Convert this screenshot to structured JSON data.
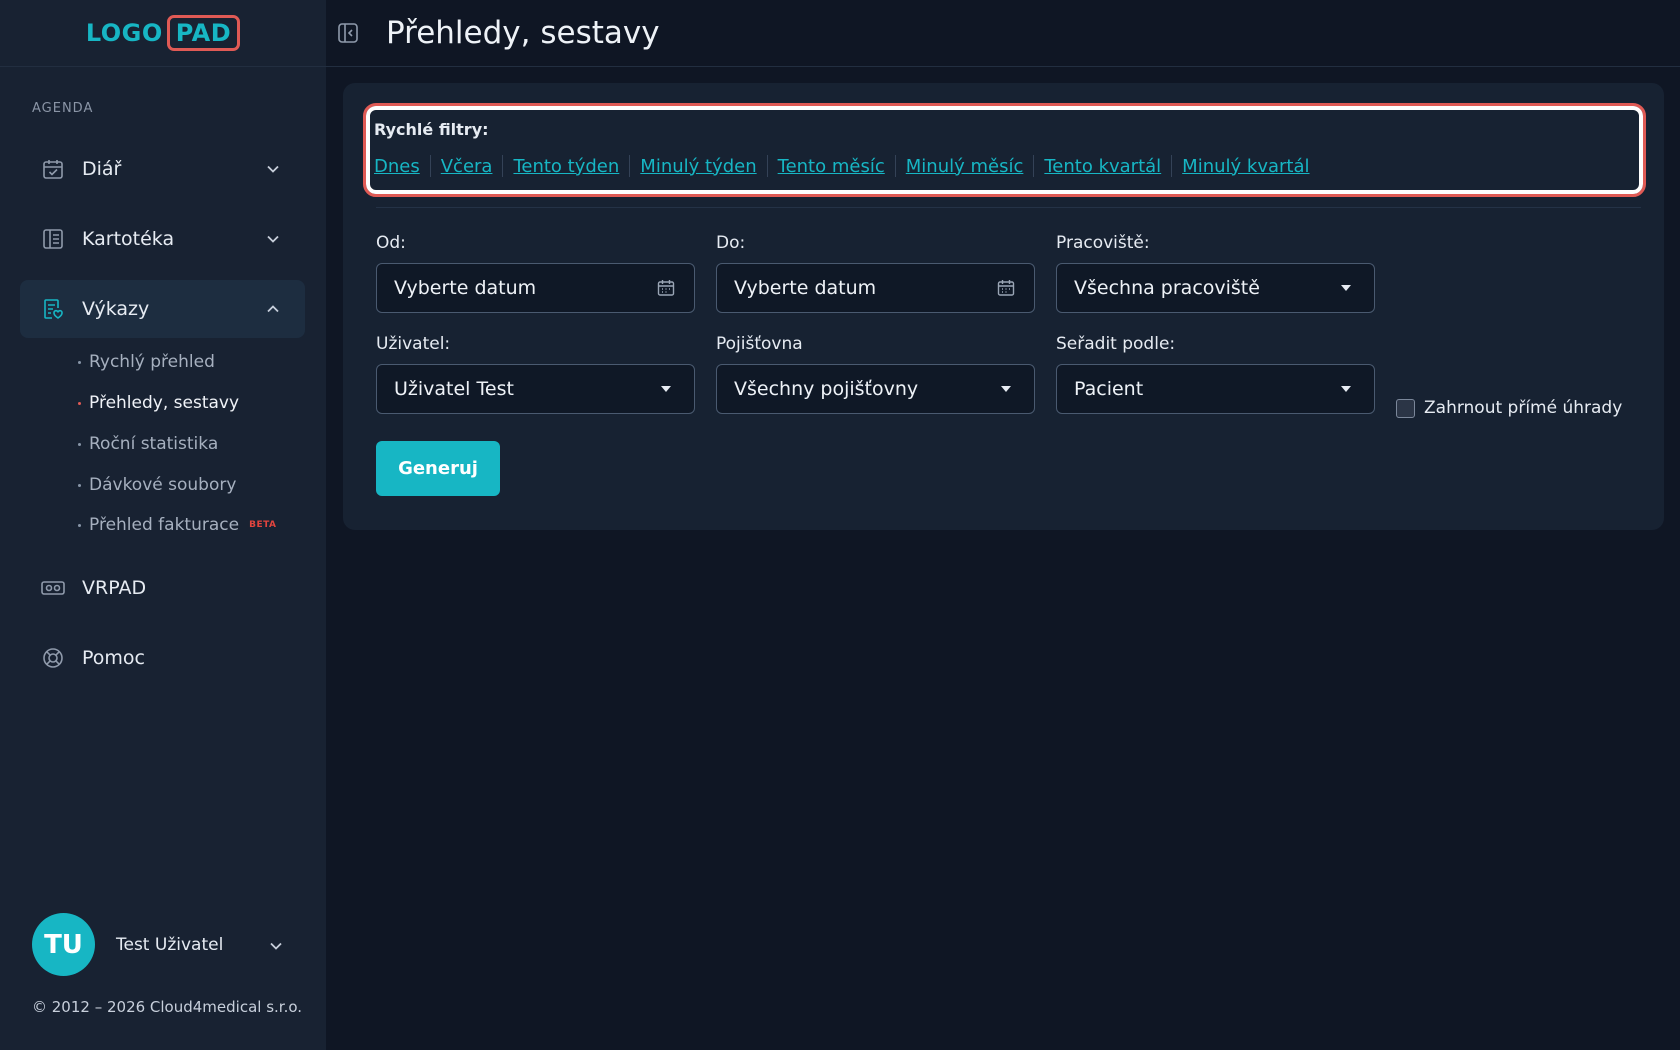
{
  "logo": {
    "part1": "LOGO",
    "part2": "PAD"
  },
  "sidebar": {
    "section": "AGENDA",
    "items": [
      {
        "label": "Diář",
        "icon": "calendar-check-icon"
      },
      {
        "label": "Kartotéka",
        "icon": "card-file-icon"
      },
      {
        "label": "Výkazy",
        "icon": "report-icon",
        "active": true
      },
      {
        "label": "VRPAD",
        "icon": "vr-headset-icon"
      },
      {
        "label": "Pomoc",
        "icon": "lifebuoy-icon"
      }
    ],
    "subitems": [
      {
        "label": "Rychlý přehled"
      },
      {
        "label": "Přehledy, sestavy",
        "active": true
      },
      {
        "label": "Roční statistika"
      },
      {
        "label": "Dávkové soubory"
      },
      {
        "label": "Přehled fakturace",
        "badge": "BETA"
      }
    ],
    "user": {
      "initials": "TU",
      "name": "Test Uživatel"
    },
    "copyright": "© 2012 – 2026 Cloud4medical s.r.o."
  },
  "header": {
    "title": "Přehledy, sestavy"
  },
  "quick_filters": {
    "label": "Rychlé filtry:",
    "links": [
      "Dnes",
      "Včera",
      "Tento týden",
      "Minulý týden",
      "Tento měsíc",
      "Minulý měsíc",
      "Tento kvartál",
      "Minulý kvartál"
    ]
  },
  "form": {
    "from": {
      "label": "Od:",
      "value": "Vyberte datum"
    },
    "to": {
      "label": "Do:",
      "value": "Vyberte datum"
    },
    "workplace": {
      "label": "Pracoviště:",
      "value": "Všechna pracoviště"
    },
    "user": {
      "label": "Uživatel:",
      "value": "Uživatel Test"
    },
    "insurance": {
      "label": "Pojišťovna",
      "value": "Všechny pojišťovny"
    },
    "sort": {
      "label": "Seřadit podle:",
      "value": "Pacient"
    },
    "include_direct": {
      "label": "Zahrnout přímé úhrady",
      "checked": false
    },
    "generate": "Generuj"
  },
  "colors": {
    "accent": "#17b6c4",
    "highlight": "#e05a55",
    "background": "#0f1624",
    "sidebar": "#182232"
  }
}
